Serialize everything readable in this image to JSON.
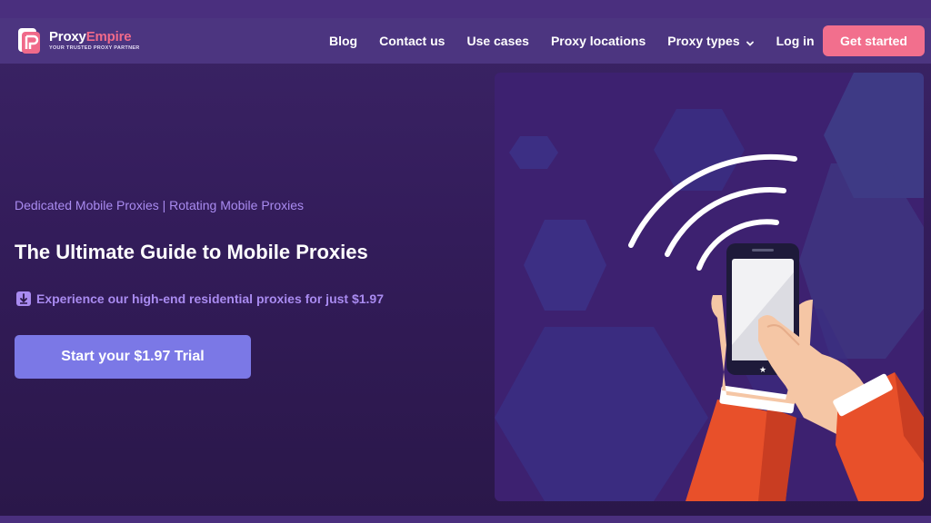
{
  "brand": {
    "name_part1": "Proxy",
    "name_part2": "Empire",
    "tagline": "YOUR TRUSTED PROXY PARTNER",
    "accent_color": "#f26f8d",
    "nav_bg": "#4c3580"
  },
  "nav": {
    "items": [
      {
        "label": "Blog"
      },
      {
        "label": "Contact us"
      },
      {
        "label": "Use cases"
      },
      {
        "label": "Proxy locations"
      },
      {
        "label": "Proxy types",
        "icon": "chevron-down-icon"
      },
      {
        "label": "Log in"
      }
    ],
    "cta_label": "Get started"
  },
  "hero": {
    "subtitle": "Dedicated Mobile Proxies | Rotating Mobile Proxies",
    "title": "The Ultimate Guide to Mobile Proxies",
    "offer_icon": "download-arrow-icon",
    "offer_text": "Experience our high-end residential proxies for just $1.97",
    "trial_button_label": "Start your $1.97 Trial",
    "button_color": "#7b78e6"
  },
  "illustration": {
    "description_icon": "phone-signal-illustration",
    "panel_color": "#3d2170"
  }
}
